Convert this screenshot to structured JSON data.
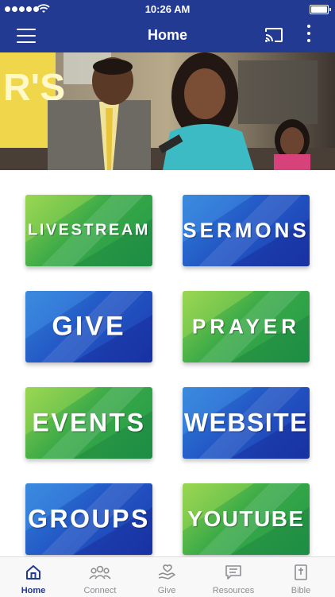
{
  "status_bar": {
    "time": "10:26 AM"
  },
  "nav": {
    "title": "Home"
  },
  "tiles": [
    {
      "label": "LIVESTREAM",
      "color": "green"
    },
    {
      "label": "SERMONS",
      "color": "blue"
    },
    {
      "label": "GIVE",
      "color": "blue"
    },
    {
      "label": "PRAYER",
      "color": "green"
    },
    {
      "label": "EVENTS",
      "color": "green"
    },
    {
      "label": "WEBSITE",
      "color": "blue"
    },
    {
      "label": "GROUPS",
      "color": "blue"
    },
    {
      "label": "YOUTUBE",
      "color": "green"
    }
  ],
  "tab_bar": {
    "items": [
      {
        "label": "Home",
        "icon": "home-icon",
        "active": true
      },
      {
        "label": "Connect",
        "icon": "people-icon",
        "active": false
      },
      {
        "label": "Give",
        "icon": "hand-heart-icon",
        "active": false
      },
      {
        "label": "Resources",
        "icon": "message-icon",
        "active": false
      },
      {
        "label": "Bible",
        "icon": "bible-icon",
        "active": false
      }
    ]
  },
  "colors": {
    "nav_blue": "#233a92",
    "tile_green": "#3aaa47",
    "tile_blue": "#2358c6",
    "tab_active": "#233a92",
    "tab_inactive": "#8e8e93"
  }
}
